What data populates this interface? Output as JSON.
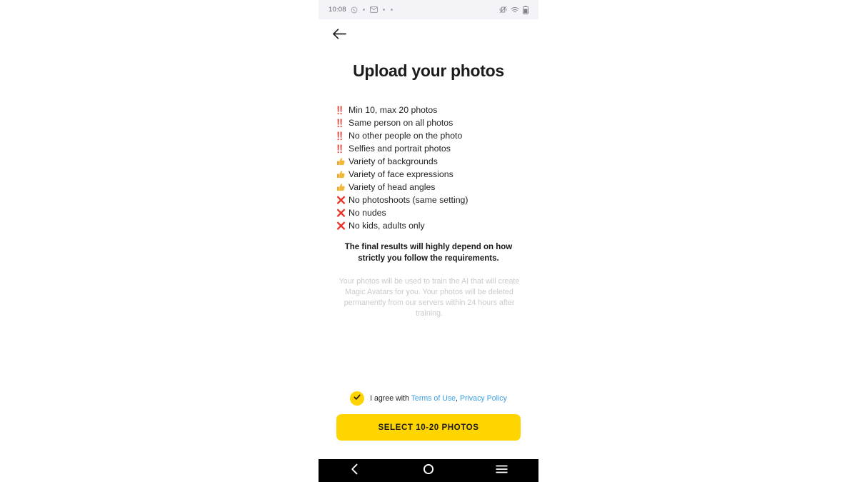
{
  "status_bar": {
    "time": "10:08",
    "left_icons": [
      "whatsapp-icon",
      "dot-icon",
      "message-icon",
      "dot-icon",
      "dot-icon"
    ],
    "right_icons": [
      "vibrate-off-icon",
      "wifi-icon",
      "battery-icon"
    ]
  },
  "header": {
    "back_icon": "back-arrow-icon",
    "title": "Upload your photos"
  },
  "requirements": [
    {
      "marker": "double-exclamation",
      "label": "Min 10, max 20 photos"
    },
    {
      "marker": "double-exclamation",
      "label": "Same person on all photos"
    },
    {
      "marker": "double-exclamation",
      "label": "No other people on the photo"
    },
    {
      "marker": "double-exclamation",
      "label": "Selfies and portrait photos"
    },
    {
      "marker": "thumbs-up",
      "label": "Variety of backgrounds"
    },
    {
      "marker": "thumbs-up",
      "label": "Variety of face expressions"
    },
    {
      "marker": "thumbs-up",
      "label": "Variety of head angles"
    },
    {
      "marker": "cross-mark",
      "label": "No photoshoots (same setting)"
    },
    {
      "marker": "cross-mark",
      "label": "No nudes"
    },
    {
      "marker": "cross-mark",
      "label": "No kids, adults only"
    }
  ],
  "emphasis": "The final results will highly depend on how strictly you follow the requirements.",
  "disclaimer": "Your photos will be used to train the AI that will create Magic Avatars for you. Your photos will be deleted permanently from our servers within 24 hours after training.",
  "agreement": {
    "checked": true,
    "prefix": "I agree with ",
    "terms_label": "Terms of Use",
    "separator": ", ",
    "privacy_label": "Privacy Policy"
  },
  "cta": {
    "label": "SELECT 10-20 PHOTOS"
  },
  "nav_bar": {
    "back_label": "back",
    "home_label": "home",
    "recents_label": "recents"
  },
  "colors": {
    "accent_yellow": "#FFD500",
    "link_blue": "#3b9fe3",
    "status_bar_bg": "#f3f3f8",
    "nav_bar_bg": "#000000",
    "marker_red": "#e8392c",
    "marker_gold": "#f2b735"
  }
}
